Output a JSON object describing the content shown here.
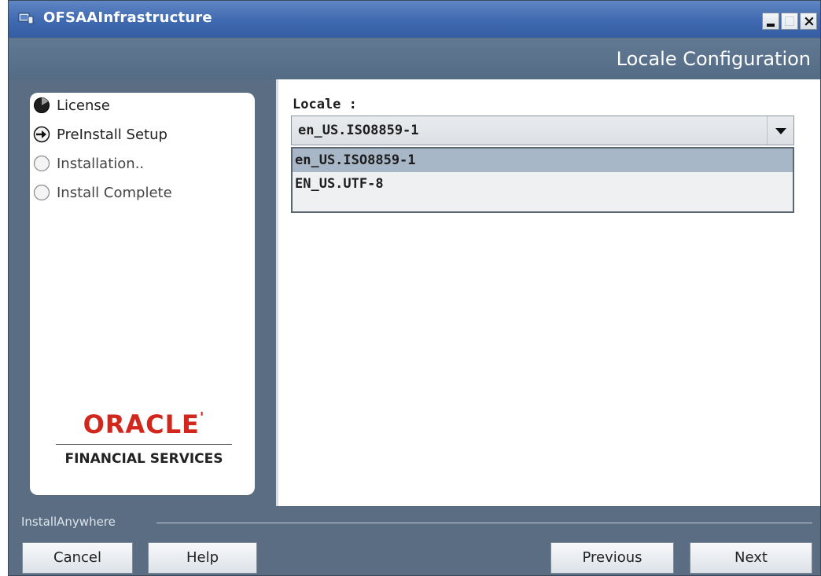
{
  "window": {
    "title": "OFSAAInfrastructure",
    "header": "Locale Configuration"
  },
  "steps": [
    {
      "label": "License",
      "state": "completed"
    },
    {
      "label": "PreInstall Setup",
      "state": "current"
    },
    {
      "label": "Installation..",
      "state": "pending"
    },
    {
      "label": "Install Complete",
      "state": "pending"
    }
  ],
  "logo": {
    "brand": "ORACLE",
    "brand_mark": "'",
    "tagline": "FINANCIAL SERVICES"
  },
  "locale": {
    "label": "Locale :",
    "selected": "en_US.ISO8859-1",
    "options": [
      "en_US.ISO8859-1",
      "EN_US.UTF-8"
    ]
  },
  "footer": {
    "installer_label": "InstallAnywhere",
    "cancel_label": "Cancel",
    "help_label": "Help",
    "previous_label": "Previous",
    "next_label": "Next"
  },
  "colors": {
    "title_bar": "#3f69b0",
    "header_band": "#5a6f88",
    "oracle_red": "#d2271d",
    "selected_option": "#a8b7c8"
  }
}
